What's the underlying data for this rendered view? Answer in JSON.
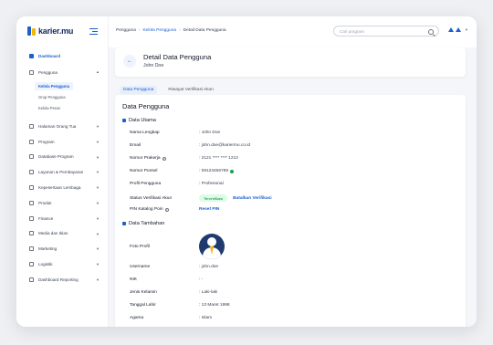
{
  "app": {
    "logo_text": "karier.mu"
  },
  "sidebar": {
    "items": [
      {
        "label": "Dashboard",
        "active": true
      },
      {
        "label": "Pengguna",
        "active": false,
        "expanded": true
      },
      {
        "label": "Halaman Orang Tua"
      },
      {
        "label": "Program"
      },
      {
        "label": "Database Program"
      },
      {
        "label": "Layanan & Pembayaran"
      },
      {
        "label": "Kepesertaan Lembaga"
      },
      {
        "label": "Produk"
      },
      {
        "label": "Finance"
      },
      {
        "label": "Media dan Iklan"
      },
      {
        "label": "Marketing"
      },
      {
        "label": "Logistik"
      },
      {
        "label": "Dashboard Reporting"
      }
    ],
    "subitems": [
      {
        "label": "Kelola Pengguna",
        "active": true
      },
      {
        "label": "Grup Pengguna"
      },
      {
        "label": "Kelola Peran"
      }
    ]
  },
  "topbar": {
    "breadcrumb": [
      "Pengguna",
      "Kelola Pengguna",
      "Detail Data Pengguna"
    ],
    "search_placeholder": "Cari program"
  },
  "header": {
    "title": "Detail Data Pengguna",
    "subtitle": "John Doe"
  },
  "tabs": [
    {
      "label": "Data Pengguna",
      "active": true
    },
    {
      "label": "Riwayat Verifikasi Akun",
      "active": false
    }
  ],
  "main": {
    "title": "Data Pengguna",
    "section1": {
      "title": "Data Utama",
      "rows": [
        {
          "label": "Nama Lengkap",
          "value": ": John Doe"
        },
        {
          "label": "Email",
          "value": ": john.doe@kariermu.co.id"
        },
        {
          "label": "Nomor Prakerja",
          "value": ": 2121 **** **** 1212"
        },
        {
          "label": "Nomor Ponsel",
          "value": ": 08123456789"
        },
        {
          "label": "Profil Pengguna",
          "value": ": Profesional"
        },
        {
          "label": "Status Verifikasi Akun",
          "badge": "Terverifikasi",
          "action": "Batalkan Verifikasi"
        },
        {
          "label": "PIN Katalog Poin",
          "action": "Reset PIN"
        }
      ]
    },
    "section2": {
      "title": "Data Tambahan",
      "rows": [
        {
          "label": "Foto Profil"
        },
        {
          "label": "Username",
          "value": ": john.doe"
        },
        {
          "label": "NIK",
          "value": ": -"
        },
        {
          "label": "Jenis Kelamin",
          "value": ": Laki-laki"
        },
        {
          "label": "Tanggal Lahir",
          "value": ": 13 Maret 1998"
        },
        {
          "label": "Agama",
          "value": ": Islam"
        }
      ]
    }
  }
}
